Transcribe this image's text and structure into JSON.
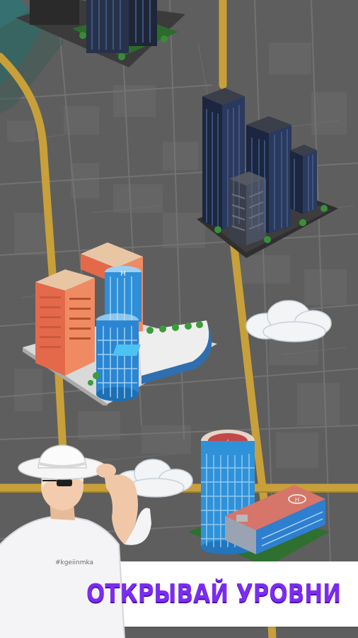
{
  "promo": {
    "headline": "ОТКРЫВАЙ УРОВНИ",
    "shirt_text": "#kgeiinmka",
    "headline_color": "#7b2cf0"
  },
  "map": {
    "background_color": "#5c5c5c",
    "road_color": "#c9a13a",
    "water_color": "#2e6f73"
  },
  "levels": [
    {
      "icon": "dark-office-towers-icon"
    },
    {
      "icon": "blue-skyscraper-cluster-icon"
    },
    {
      "icon": "hospital-complex-icon"
    },
    {
      "icon": "helipad-towers-icon"
    }
  ],
  "decor": {
    "cloud_icon": "cloud-icon",
    "character_icon": "person-in-white-hat-icon"
  }
}
